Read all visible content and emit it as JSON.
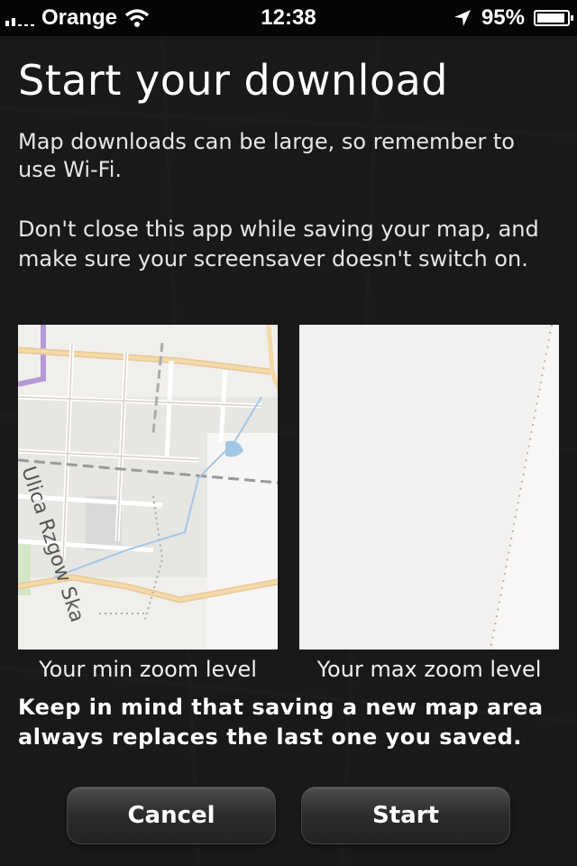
{
  "status_bar": {
    "carrier": "Orange",
    "time": "12:38",
    "battery_percent": "95%",
    "battery_level": 0.95,
    "icons": [
      "signal-bars-icon",
      "wifi-icon",
      "location-arrow-icon",
      "battery-icon"
    ]
  },
  "dialog": {
    "title": "Start your download",
    "paragraph_1": "Map downloads can be large, so remember to use Wi-Fi.",
    "paragraph_2": "Don't close this app while saving your map, and make sure your screensaver doesn't switch on.",
    "min_zoom_caption": "Your min zoom level",
    "max_zoom_caption": "Your max zoom level",
    "warning": "Keep in mind that saving a new map area always replaces the last one you saved."
  },
  "map": {
    "street_label": "Ulica Rzgow Ska"
  },
  "buttons": {
    "cancel": "Cancel",
    "start": "Start"
  },
  "colors": {
    "road_major": "#f5d9a8",
    "road_minor": "#ffffff",
    "map_land": "#f1efec",
    "water": "#a3c8e6",
    "boundary": "#b59ad6"
  }
}
